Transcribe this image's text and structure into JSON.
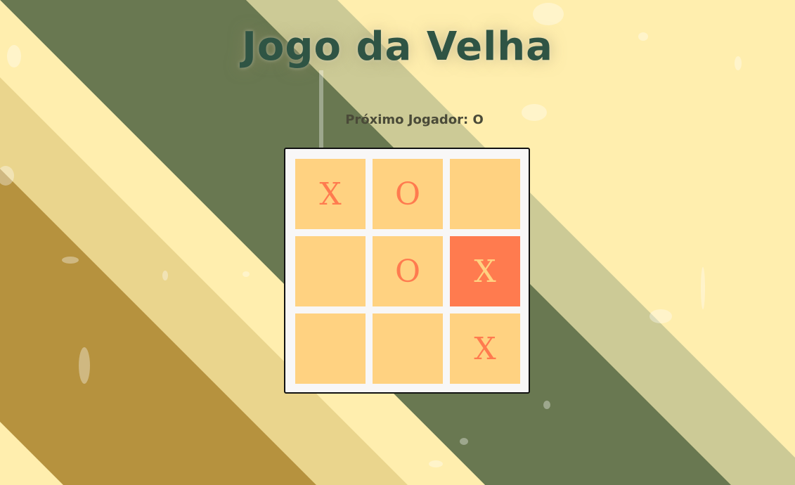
{
  "game": {
    "title": "Jogo da Velha",
    "status_text": "Próximo Jogador: O"
  },
  "board": {
    "cells": [
      "X",
      "O",
      "",
      "",
      "O",
      "X",
      "",
      "",
      "X"
    ],
    "highlighted_cell_index": 5
  },
  "colors": {
    "background_light": "#ffeeae",
    "stripe_olive": "#697851",
    "stripe_sage": "#ccca96",
    "stripe_tan": "#ead58d",
    "stripe_mustard": "#b6923e",
    "cell": "#ffd281",
    "mark": "#ff7b4f",
    "title": "#2f5444"
  }
}
